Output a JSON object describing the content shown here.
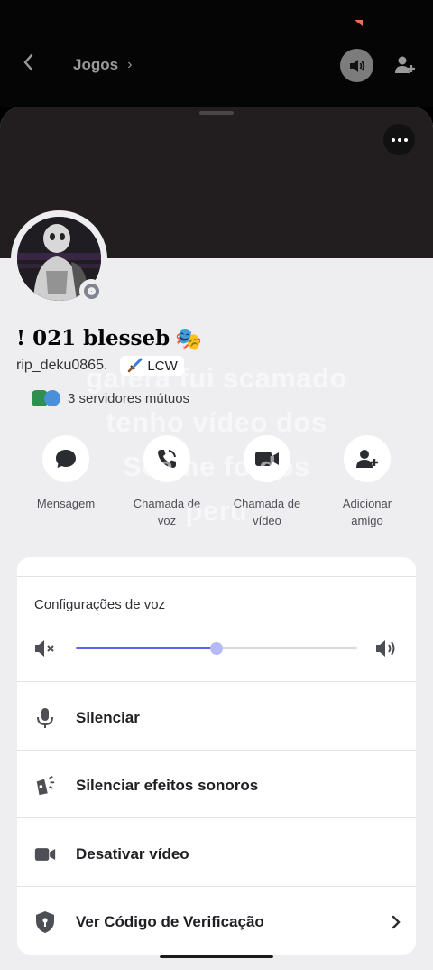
{
  "header": {
    "back_icon": "chevron-left-icon",
    "channel_name": "Jogos",
    "channel_chevron": "›",
    "speaker_icon": "speaker-icon",
    "add_user_icon": "add-user-icon"
  },
  "profile": {
    "display_name": "! 021 blesseb",
    "display_emoji": "🎭",
    "username": "rip_deku0865.",
    "tag_icon": "sword-icon",
    "tag_label": "LCW",
    "mutual_servers": "3 servidores mútuos",
    "status": "offline"
  },
  "overlay_caption": [
    "galera fui scamado",
    "tenho vídeo dos",
    "Scame fo dos",
    "peru"
  ],
  "actions": [
    {
      "icon": "chat-bubble-icon",
      "label_line1": "Mensagem",
      "label_line2": ""
    },
    {
      "icon": "phone-call-icon",
      "label_line1": "Chamada de",
      "label_line2": "voz"
    },
    {
      "icon": "video-camera-icon",
      "label_line1": "Chamada de",
      "label_line2": "vídeo"
    },
    {
      "icon": "add-friend-icon",
      "label_line1": "Adicionar",
      "label_line2": "amigo"
    }
  ],
  "voice_settings": {
    "title": "Configurações de voz",
    "volume_fraction": 0.5,
    "mute_icon": "speaker-muted-icon",
    "max_icon": "speaker-loud-icon"
  },
  "menu": [
    {
      "icon": "microphone-icon",
      "label": "Silenciar"
    },
    {
      "icon": "soundboard-mute-icon",
      "label": "Silenciar efeitos sonoros"
    },
    {
      "icon": "video-camera-icon",
      "label": "Desativar vídeo"
    },
    {
      "icon": "shield-lock-icon",
      "label": "Ver Código de Verificação"
    }
  ],
  "colors": {
    "accent": "#5865f2",
    "sheet_bg": "#eeeef1",
    "banner": "#221e20"
  }
}
